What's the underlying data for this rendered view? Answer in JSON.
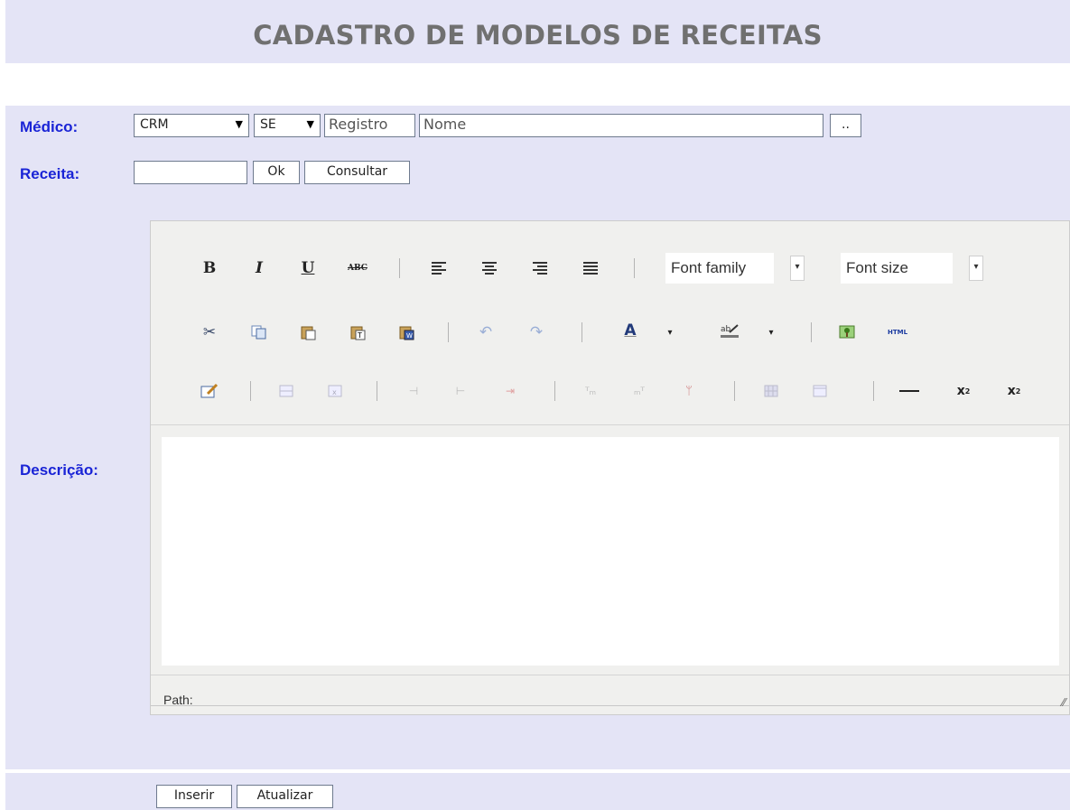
{
  "page": {
    "title": "CADASTRO DE MODELOS DE RECEITAS"
  },
  "medico": {
    "label": "Médico:",
    "conselho_select": "CRM",
    "uf_select": "SE",
    "registro_placeholder": "Registro",
    "nome_placeholder": "Nome",
    "lookup_button": ".."
  },
  "receita": {
    "label": "Receita:",
    "value": "",
    "ok_button": "Ok",
    "consultar_button": "Consultar"
  },
  "descricao": {
    "label": "Descrição:",
    "toolbar": {
      "font_family": "Font family",
      "font_size": "Font size",
      "bold": "B",
      "italic": "I",
      "underline": "U",
      "strikethrough": "ABC",
      "html": "HTML"
    },
    "path_label": "Path:"
  },
  "actions": {
    "inserir": "Inserir",
    "atualizar": "Atualizar"
  }
}
